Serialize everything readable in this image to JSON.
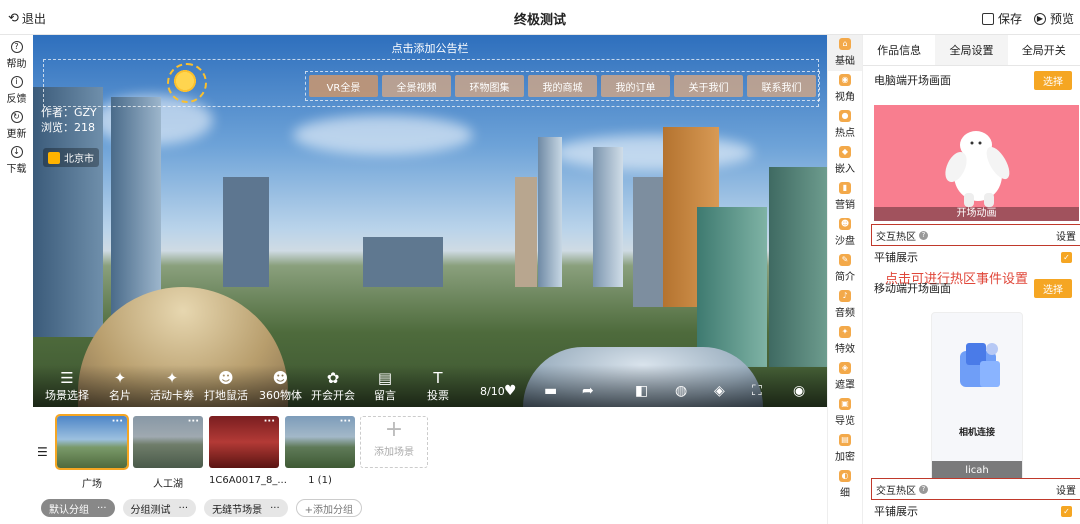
{
  "topbar": {
    "exit": "退出",
    "title": "终极测试",
    "save": "保存",
    "preview": "预览"
  },
  "leftbar": [
    {
      "label": "帮助",
      "glyph": "?"
    },
    {
      "label": "反馈",
      "glyph": "i"
    },
    {
      "label": "更新",
      "glyph": "↻"
    },
    {
      "label": "下载",
      "glyph": "↓"
    }
  ],
  "viewer": {
    "notice": "点击添加公告栏",
    "menu": [
      "VR全景",
      "全景视频",
      "环物图集",
      "我的商城",
      "我的订单",
      "关于我们",
      "联系我们"
    ],
    "author": "作者：GZY",
    "views": "浏览：218",
    "location": "北京市",
    "toolbar": [
      "场景选择",
      "名片",
      "活动卡劵",
      "打地鼠活",
      "360物体",
      "开会开会",
      "留言",
      "投票"
    ],
    "counter": "8/10",
    "icons": [
      "heart-icon",
      "comment-icon",
      "share-icon",
      "layout-icon",
      "vr-glasses-icon",
      "gyro-icon",
      "fullscreen-icon",
      "eye-icon"
    ]
  },
  "scenes": {
    "items": [
      {
        "label": "广场",
        "selected": true
      },
      {
        "label": "人工湖",
        "selected": false
      },
      {
        "label": "1C6A0017_8_...",
        "selected": false
      },
      {
        "label": "1 (1)",
        "selected": false
      }
    ],
    "add_label": "添加场景",
    "groups": [
      "默认分组",
      "分组测试",
      "无缝节场景"
    ],
    "add_group": "+添加分组",
    "more": "···"
  },
  "toolcol": [
    "基础",
    "视角",
    "热点",
    "嵌入",
    "营销",
    "沙盘",
    "简介",
    "音频",
    "特效",
    "遮罩",
    "导览",
    "加密",
    "细"
  ],
  "panel": {
    "tabs": [
      "作品信息",
      "全局设置",
      "全局开关"
    ],
    "pc_title": "电脑端开场画面",
    "select": "选择",
    "pc_caption": "开场动画",
    "hot_label": "交互热区",
    "hot_action": "设置",
    "tile_label": "平铺展示",
    "annotation": "点击可进行热区事件设置",
    "mobile_title": "移动端开场画面",
    "mobile_caption": "licah",
    "mobile_heading": "相机连接",
    "hot_label_2": "交互热区",
    "hot_action_2": "设置",
    "tile_label_2": "平铺展示"
  },
  "colors": {
    "accent": "#f5a623",
    "annotation": "#e0473a",
    "pink": "#f87e8f"
  }
}
